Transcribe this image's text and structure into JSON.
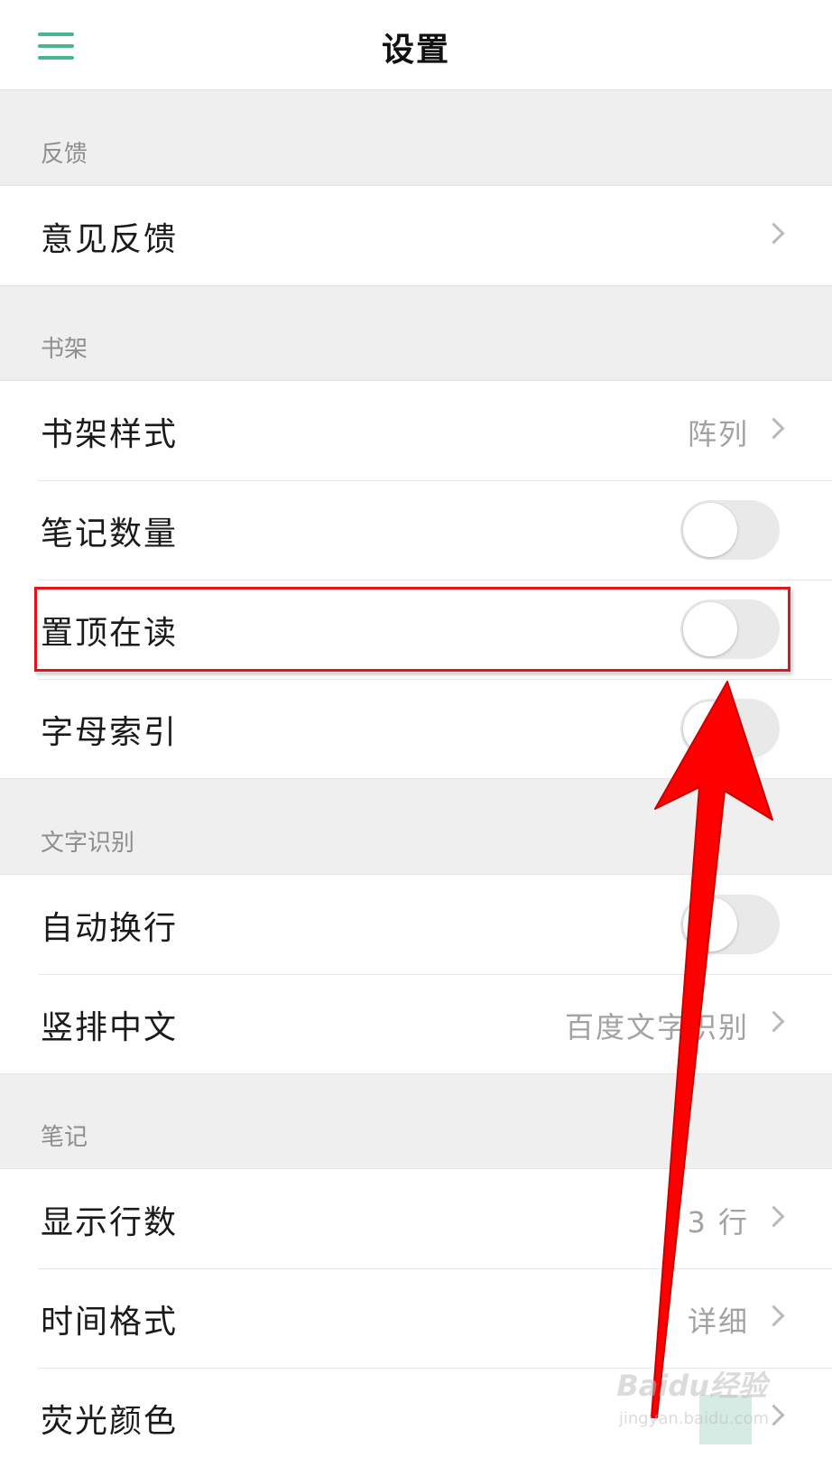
{
  "header": {
    "title": "设置",
    "menu_icon": "hamburger-menu-icon"
  },
  "sections": [
    {
      "label": "反馈",
      "rows": [
        {
          "label": "意见反馈",
          "control": "chevron"
        }
      ]
    },
    {
      "label": "书架",
      "rows": [
        {
          "label": "书架样式",
          "value": "阵列",
          "control": "chevron"
        },
        {
          "label": "笔记数量",
          "control": "toggle",
          "on": false
        },
        {
          "label": "置顶在读",
          "control": "toggle",
          "on": false,
          "highlighted": true
        },
        {
          "label": "字母索引",
          "control": "toggle",
          "on": false
        }
      ]
    },
    {
      "label": "文字识别",
      "rows": [
        {
          "label": "自动换行",
          "control": "toggle",
          "on": false
        },
        {
          "label": "竖排中文",
          "value": "百度文字识别",
          "control": "chevron"
        }
      ]
    },
    {
      "label": "笔记",
      "rows": [
        {
          "label": "显示行数",
          "value": "3 行",
          "control": "chevron"
        },
        {
          "label": "时间格式",
          "value": "详细",
          "control": "chevron"
        },
        {
          "label": "荧光颜色",
          "control": "chevron"
        }
      ]
    }
  ],
  "annotation": {
    "highlight_color": "#e0141c",
    "arrow_color": "#ff0000"
  },
  "watermark": {
    "brand": "Baidu经验",
    "url": "jingyan.baidu.com"
  },
  "colors": {
    "accent": "#46b88a",
    "background": "#efefef",
    "toggle_off": "#e9e9e9"
  }
}
